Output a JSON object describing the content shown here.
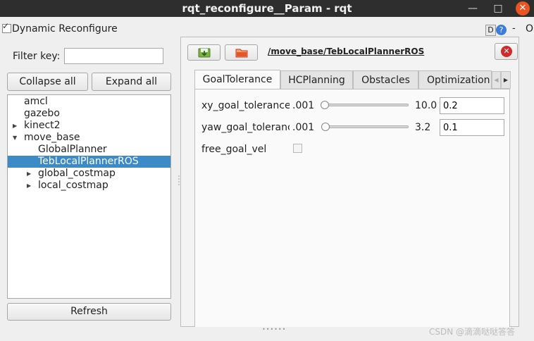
{
  "window": {
    "title": "rqt_reconfigure__Param - rqt",
    "minimize": "—",
    "maximize": "□",
    "close": "✕"
  },
  "plugin": {
    "title": "Dynamic Reconfigure",
    "d_label": "D",
    "help_label": "?",
    "dash_label": "-",
    "o_label": "O"
  },
  "filter": {
    "label": "Filter key:",
    "value": "",
    "placeholder": ""
  },
  "buttons": {
    "collapse_all": "Collapse all",
    "expand_all": "Expand all",
    "refresh": "Refresh"
  },
  "tree": {
    "items": [
      {
        "label": "amcl",
        "arrow": ""
      },
      {
        "label": "gazebo",
        "arrow": ""
      },
      {
        "label": "kinect2",
        "arrow": "▶"
      },
      {
        "label": "move_base",
        "arrow": "▼"
      },
      {
        "label": "GlobalPlanner",
        "arrow": ""
      },
      {
        "label": "TebLocalPlannerROS",
        "arrow": "",
        "selected": true
      },
      {
        "label": "global_costmap",
        "arrow": "▶"
      },
      {
        "label": "local_costmap",
        "arrow": "▶"
      }
    ]
  },
  "node": {
    "path": "/move_base/TebLocalPlannerROS",
    "close_label": "✕"
  },
  "tabs": [
    {
      "label": "GoalTolerance",
      "active": true
    },
    {
      "label": "HCPlanning"
    },
    {
      "label": "Obstacles"
    },
    {
      "label": "Optimization"
    }
  ],
  "tab_scroll": {
    "left": "◀",
    "right": "▶"
  },
  "params": [
    {
      "name": "xy_goal_tolerance",
      "min": ".001",
      "max": "10.0",
      "value": "0.2",
      "level": 0.02
    },
    {
      "name": "yaw_goal_tolerance",
      "min": ".001",
      "max": "3.2",
      "value": "0.1",
      "level": 0.03
    },
    {
      "name": "free_goal_vel",
      "checked": false
    }
  ],
  "watermark": "CSDN @滴滴哒哒答答",
  "colors": {
    "titlebar": "#2e2e2e",
    "close_button": "#e95420",
    "selection": "#3d8ac9",
    "node_close": "#d02a2a",
    "help_icon": "#3b7dd8"
  }
}
